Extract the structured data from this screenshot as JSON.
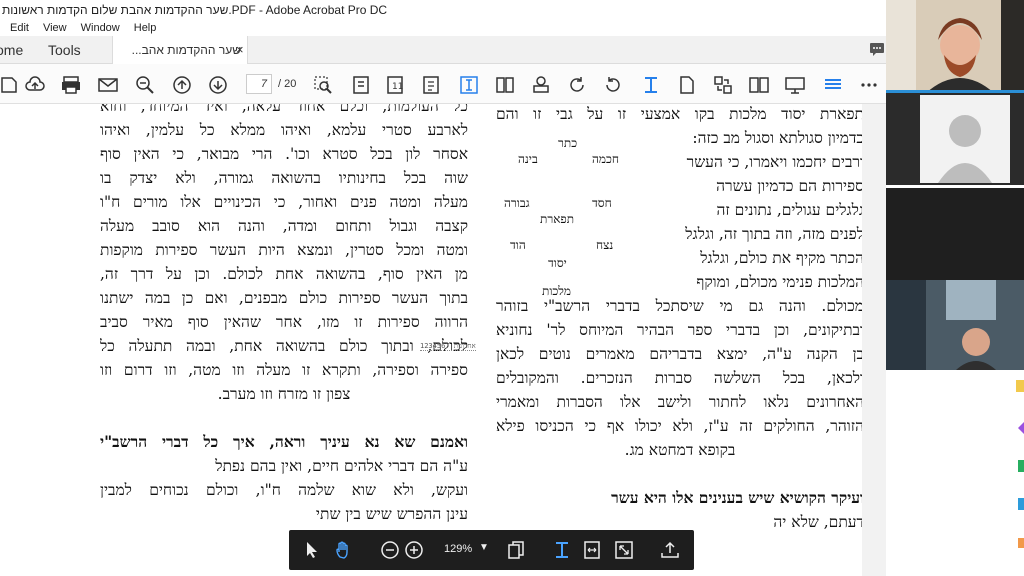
{
  "window": {
    "title": "שער ההקדמות אהבת שלום הקדמות ראשונות.PDF - Adobe Acrobat Pro DC"
  },
  "menu": {
    "items": [
      "Edit",
      "View",
      "Window",
      "Help"
    ]
  },
  "tabs": {
    "home": "ome",
    "tools": "Tools",
    "document": "שער ההקדמות אהב...",
    "close": "×"
  },
  "toolbar": {
    "page_current": "7",
    "page_total": "/ 20"
  },
  "floating_toolbar": {
    "zoom": "129%"
  },
  "document": {
    "left_column": [
      {
        "text": "כל העולמות, וכלם אחוד עלאה, ואיד המיוחד, וחוא",
        "align": "justify"
      },
      {
        "text": "לארבע סטרי עלמא, ואיהו ממלא כל עלמין, ואיהו",
        "align": "justify"
      },
      {
        "text": "אסחר לון בכל סטרא וכו'. הרי מבואר, כי האין סוף",
        "align": "justify"
      },
      {
        "text": "שוה בכל בחינותיו בהשואה גמורה, ולא יצדק בו",
        "align": "justify"
      },
      {
        "text": "מעלה ומטה פנים ואחור, כי הכינויים אלו מורים ח\"ו",
        "align": "justify"
      },
      {
        "text": "קצבה וגבול ותחום ומדה, והנה הוא סובב מעלה",
        "align": "justify"
      },
      {
        "text": "ומטה ומכל סטרין, ונמצא היות העשר ספירות מוקפות",
        "align": "justify"
      },
      {
        "text": "מן האין סוף, בהשואה אחת לכולם. וכן על דרך זה,",
        "align": "justify"
      },
      {
        "text": "בתוך העשר ספירות כולם מבפנים, ואם כן במה ישתנו",
        "align": "justify"
      },
      {
        "text": "הרווה ספירות זו מזו, אחר שהאין סוף מאיר סביב",
        "align": "justify"
      },
      {
        "text": "לכולם, ובתוך כולם בהשואה אחת, ובמה תתעלה כל",
        "align": "justify"
      },
      {
        "text": "ספירה וספירה, ותקרא זו מעלה וזו מטה, וזו דרום וזו",
        "align": "justify"
      },
      {
        "text": "צפון זו מזרח וזו מערב.",
        "align": "center"
      },
      {
        "text": "",
        "align": "center"
      },
      {
        "text": "ואמנם שא נא עיניך וראה, איך כל דברי הרשב\"י",
        "align": "justify"
      },
      {
        "text": "ע\"ה הם דברי אלהים חיים, ואין בהם נפתל",
        "align": "right"
      },
      {
        "text": "ועקש, ולא שוא שלמה ח\"ו, וכולם נכוחים למבין",
        "align": "justify"
      },
      {
        "text": "עינן ההפרש שיש בין שתי",
        "align": "right"
      }
    ],
    "right_column": [
      {
        "text": "תפארת יסוד מלכות בקו אמצעי זו על גבי זו והם",
        "align": "justify"
      },
      {
        "text": "כדמיון סגולתא וסגול מב כזה:",
        "align": "right"
      },
      {
        "text": "ורבים יחכמו ויאמרו, כי העשר",
        "align": "right"
      },
      {
        "text": "ספירות הם כדמיון עשרה",
        "align": "right"
      },
      {
        "text": "גלגלים עגולים, נתונים זה",
        "align": "right"
      },
      {
        "text": "לפנים מזה, וזה בתוך זה, וגלגל",
        "align": "right"
      },
      {
        "text": "הכתר מקיף את כולם, וגלגל",
        "align": "right"
      },
      {
        "text": "המלכות פנימי מכולם, ומוקף",
        "align": "right"
      },
      {
        "text": "מכולם. והנה גם מי שיסתכל בדברי הרשב\"י בזוהר",
        "align": "justify"
      },
      {
        "text": "ובתיקונים, וכן בדברי ספר הבהיר המיוחס לר' נחוניא",
        "align": "justify"
      },
      {
        "text": "בן הקנה ע\"ה, ימצא בדבריהם מאמרים נוטים לכאן",
        "align": "justify"
      },
      {
        "text": "ולכאן, בכל השלשה סברות הנזכרים. והמקובלים",
        "align": "justify"
      },
      {
        "text": "האחרונים נלאו לחתור ולישב אלו הסברות ומאמרי",
        "align": "justify"
      },
      {
        "text": "הזוהר, החולקים זה ע\"ז, ולא יכולו אף כי הכניסו פילא",
        "align": "justify"
      },
      {
        "text": "בקופא דמחטא מג.",
        "align": "center"
      },
      {
        "text": "",
        "align": "center"
      },
      {
        "text": "ועיקר הקושיא שיש בענינים אלו היא עשר",
        "align": "right"
      },
      {
        "text": "דעתם, שלא יה",
        "align": "right"
      }
    ],
    "sefirot": [
      "כתר",
      "חכמה",
      "בינה",
      "חסד",
      "גבורה",
      "תפארת",
      "נצח",
      "הוד",
      "יסוד",
      "מלכות"
    ],
    "stamp_text": "אחרונות 1234567"
  },
  "video": {
    "tiles": [
      "participant-1",
      "participant-2",
      "participant-3",
      "participant-4"
    ]
  }
}
